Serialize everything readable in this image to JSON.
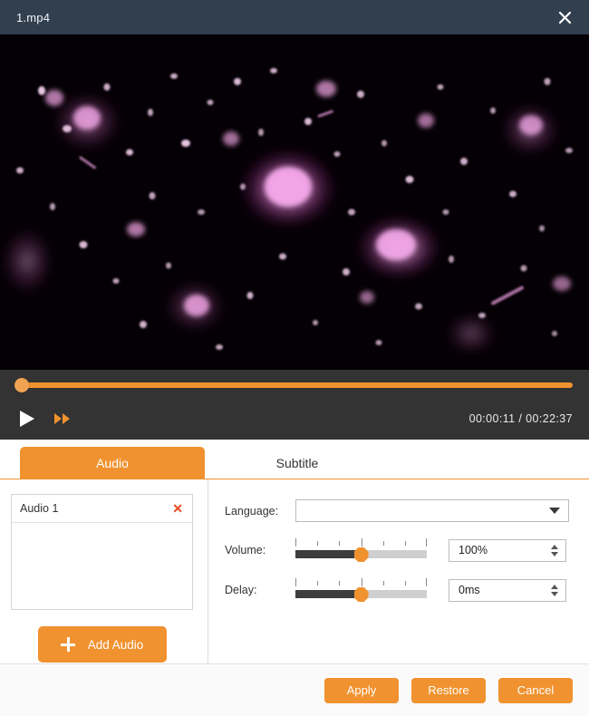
{
  "window": {
    "title": "1.mp4",
    "close_icon": "close-icon"
  },
  "player": {
    "play_icon": "play-icon",
    "fast_forward_icon": "fast-forward-icon",
    "current_time": "00:00:11",
    "total_time": "00:22:37",
    "time_separator": "/",
    "time_display": "00:00:11 / 00:22:37",
    "seek_position_percent": 0,
    "accent_color": "#f0922f"
  },
  "tabs": [
    {
      "label": "Audio",
      "active": true
    },
    {
      "label": "Subtitle",
      "active": false
    }
  ],
  "audio_panel": {
    "tracks": [
      {
        "label": "Audio 1",
        "remove_icon": "remove-icon"
      }
    ],
    "add_button": {
      "label": "Add Audio",
      "icon": "plus-icon"
    }
  },
  "settings": {
    "language": {
      "label": "Language:",
      "value": "",
      "caret_icon": "chevron-down-icon"
    },
    "volume": {
      "label": "Volume:",
      "value": "100%",
      "slider_percent": 50,
      "tick_count": 7
    },
    "delay": {
      "label": "Delay:",
      "value": "0ms",
      "slider_percent": 50,
      "tick_count": 7
    }
  },
  "footer": {
    "buttons": [
      {
        "label": "Apply"
      },
      {
        "label": "Restore"
      },
      {
        "label": "Cancel"
      }
    ]
  },
  "colors": {
    "titlebar": "#323f4f",
    "accent": "#f0922f",
    "control_bar": "#333333",
    "remove": "#e8491e"
  }
}
